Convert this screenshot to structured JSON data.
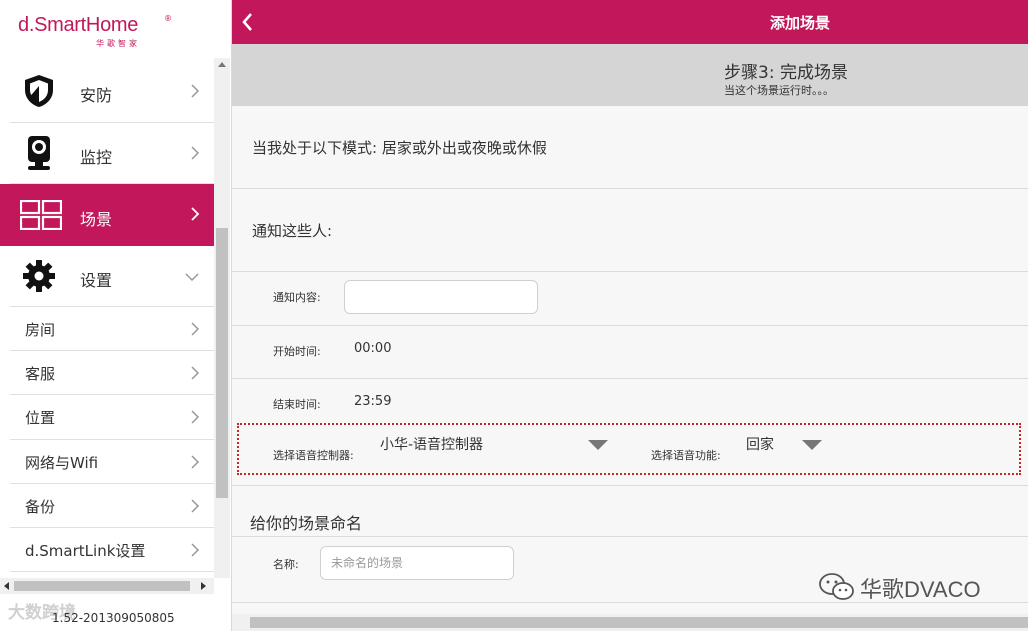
{
  "app": {
    "brand": "d.SmartHome",
    "brand_sub": "华歌智家",
    "brand_reg": "®",
    "version": "1.52-201309050805",
    "watermark_left": "大数跨境"
  },
  "colors": {
    "accent": "#c2185b",
    "stepbar": "#d5d5d5",
    "highlight_border": "#c62828"
  },
  "sidebar": {
    "big_items": [
      {
        "label": "安防",
        "icon": "shield-icon",
        "active": false
      },
      {
        "label": "监控",
        "icon": "camera-icon",
        "active": false
      },
      {
        "label": "场景",
        "icon": "scene-icon",
        "active": true
      },
      {
        "label": "设置",
        "icon": "gear-icon",
        "active": false,
        "expanded": true
      }
    ],
    "sub_items": [
      {
        "label": "房间"
      },
      {
        "label": "客服"
      },
      {
        "label": "位置"
      },
      {
        "label": "网络与Wifi"
      },
      {
        "label": "备份"
      },
      {
        "label": "d.SmartLink设置"
      }
    ]
  },
  "header": {
    "title": "添加场景"
  },
  "step": {
    "title": "步骤3: 完成场景",
    "subtitle": "当这个场景运行时。。。"
  },
  "form": {
    "mode_text": "当我处于以下模式: 居家或外出或夜晚或休假",
    "notify_text": "通知这些人:",
    "content_label": "通知内容:",
    "content_value": "",
    "start_label": "开始时间:",
    "start_value": "00:00",
    "end_label": "结束时间:",
    "end_value": "23:59",
    "voice_controller_label": "选择语音控制器:",
    "voice_controller_value": "小华-语音控制器",
    "voice_function_label": "选择语音功能:",
    "voice_function_value": "回家",
    "name_heading": "给你的场景命名",
    "name_label": "名称:",
    "name_placeholder": "未命名的场景"
  },
  "watermark_right": "华歌DVACO"
}
